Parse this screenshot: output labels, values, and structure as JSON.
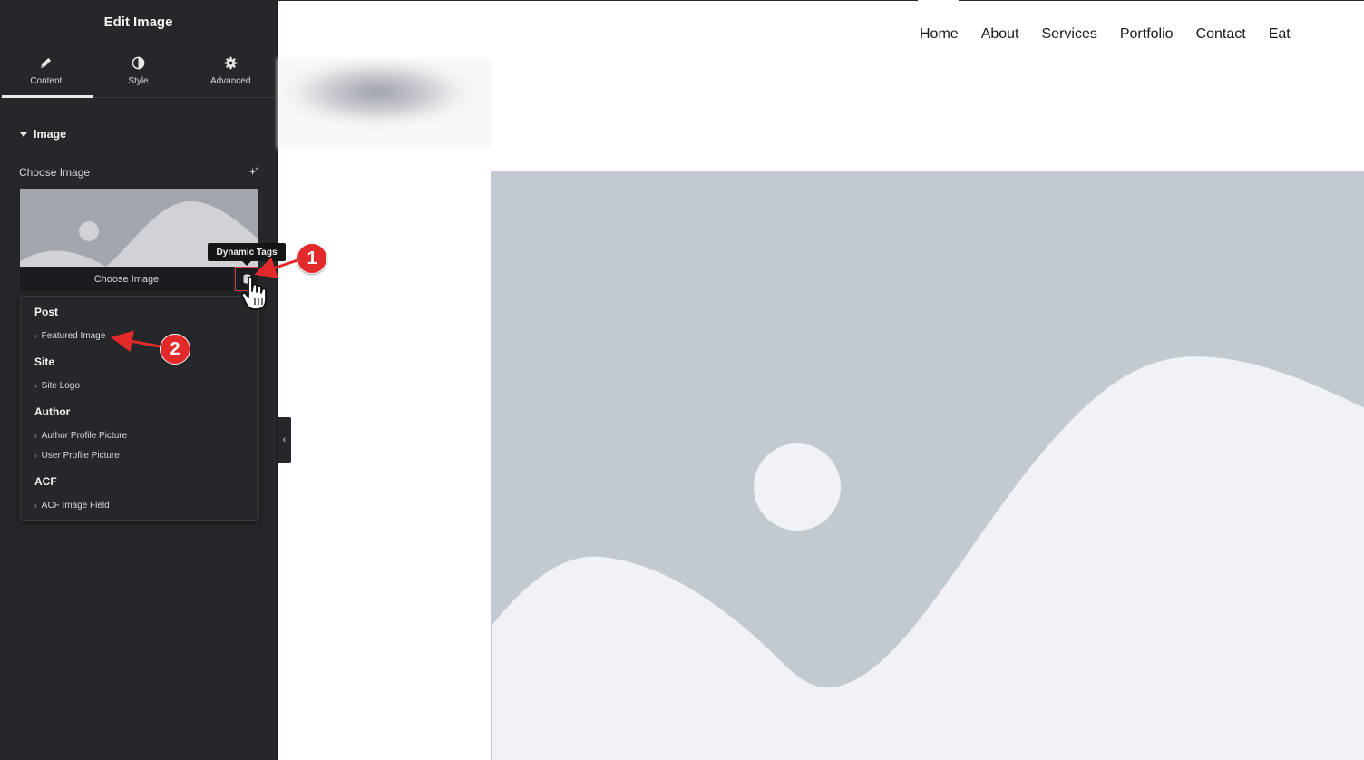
{
  "sidebar": {
    "title": "Edit Image",
    "tabs": [
      {
        "label": "Content",
        "icon": "pencil-icon",
        "active": true
      },
      {
        "label": "Style",
        "icon": "contrast-icon",
        "active": false
      },
      {
        "label": "Advanced",
        "icon": "gear-icon",
        "active": false
      }
    ],
    "section_title": "Image",
    "choose_label": "Choose Image",
    "choose_button": "Choose Image",
    "tooltip": "Dynamic Tags",
    "collapse_glyph": "‹"
  },
  "dropdown": {
    "groups": [
      {
        "label": "Post",
        "items": [
          "Featured Image"
        ]
      },
      {
        "label": "Site",
        "items": [
          "Site Logo"
        ]
      },
      {
        "label": "Author",
        "items": [
          "Author Profile Picture",
          "User Profile Picture"
        ]
      },
      {
        "label": "ACF",
        "items": [
          "ACF Image Field"
        ]
      }
    ]
  },
  "nav": {
    "items": [
      "Home",
      "About",
      "Services",
      "Portfolio",
      "Contact",
      "Eat"
    ]
  },
  "annotations": {
    "step1": "1",
    "step2": "2"
  },
  "colors": {
    "sidebar_bg": "#26272b",
    "annotation_red": "#e22a2a",
    "placeholder_sky": "#c2cad1",
    "placeholder_hill": "#f1f2f6"
  }
}
